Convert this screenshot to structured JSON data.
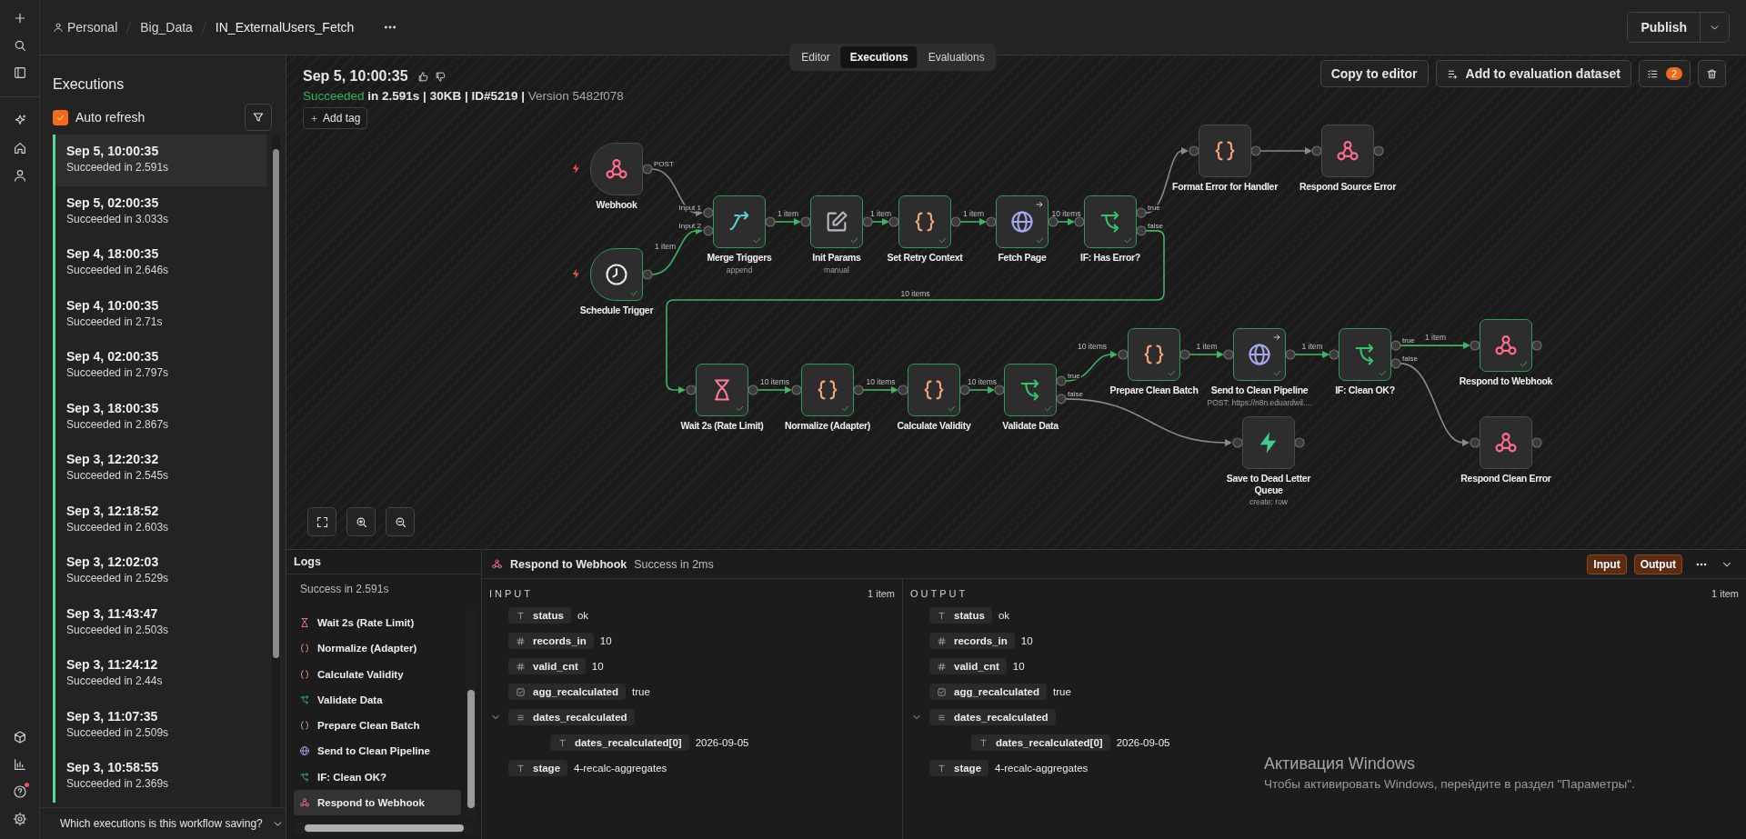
{
  "rail": {
    "top": [
      {
        "kind": "add",
        "alert": false
      },
      {
        "kind": "search",
        "alert": false
      },
      {
        "kind": "panel",
        "alert": false
      },
      {
        "kind": "sparkle",
        "alert": false
      },
      {
        "kind": "home",
        "alert": false
      },
      {
        "kind": "user",
        "alert": false
      }
    ],
    "bottom": [
      {
        "kind": "cube",
        "alert": false
      },
      {
        "kind": "chart",
        "alert": false
      },
      {
        "kind": "help",
        "alert": true
      },
      {
        "kind": "settings",
        "alert": false
      }
    ]
  },
  "breadcrumb": [
    "Personal",
    "Big_Data",
    "IN_ExternalUsers_Fetch"
  ],
  "view_tabs": [
    {
      "label": "Editor",
      "selected": false
    },
    {
      "label": "Executions",
      "selected": true
    },
    {
      "label": "Evaluations",
      "selected": false
    }
  ],
  "publish": {
    "label": "Publish"
  },
  "executions": {
    "title": "Executions",
    "auto_refresh": {
      "label": "Auto refresh",
      "checked": true
    },
    "items": [
      {
        "time": "Sep 5, 10:00:35",
        "status": "Succeeded in 2.591s",
        "selected": true
      },
      {
        "time": "Sep 5, 02:00:35",
        "status": "Succeeded in 3.033s",
        "selected": false
      },
      {
        "time": "Sep 4, 18:00:35",
        "status": "Succeeded in 2.646s",
        "selected": false
      },
      {
        "time": "Sep 4, 10:00:35",
        "status": "Succeeded in 2.71s",
        "selected": false
      },
      {
        "time": "Sep 4, 02:00:35",
        "status": "Succeeded in 2.797s",
        "selected": false
      },
      {
        "time": "Sep 3, 18:00:35",
        "status": "Succeeded in 2.867s",
        "selected": false
      },
      {
        "time": "Sep 3, 12:20:32",
        "status": "Succeeded in 2.545s",
        "selected": false
      },
      {
        "time": "Sep 3, 12:18:52",
        "status": "Succeeded in 2.603s",
        "selected": false
      },
      {
        "time": "Sep 3, 12:02:03",
        "status": "Succeeded in 2.529s",
        "selected": false
      },
      {
        "time": "Sep 3, 11:43:47",
        "status": "Succeeded in 2.503s",
        "selected": false
      },
      {
        "time": "Sep 3, 11:24:12",
        "status": "Succeeded in 2.44s",
        "selected": false
      },
      {
        "time": "Sep 3, 11:07:35",
        "status": "Succeeded in 2.509s",
        "selected": false
      },
      {
        "time": "Sep 3, 10:58:55",
        "status": "Succeeded in 2.369s",
        "selected": false
      }
    ],
    "footer": "Which executions is this workflow saving?"
  },
  "execution": {
    "title": "Sep 5, 10:00:35",
    "status": "Succeeded",
    "details": "in 2.591s | 30KB | ID#5219 |",
    "version": "Version 5482f078",
    "add_tag": "Add tag",
    "copy": "Copy to editor",
    "add_dataset": "Add to evaluation dataset",
    "badge": "2"
  },
  "nodes": [
    {
      "name": "Webhook",
      "kind": "trigger",
      "executed": false,
      "link_arrow": false,
      "outputs": [
        "POST"
      ]
    },
    {
      "name": "Schedule Trigger",
      "kind": "trigger",
      "executed": true,
      "link_arrow": false
    },
    {
      "name": "Merge Triggers",
      "subtitle": "append",
      "kind": "action",
      "executed": true,
      "link_arrow": false,
      "inputs": [
        "Input 1",
        "Input 2"
      ]
    },
    {
      "name": "Init Params",
      "subtitle": "manual",
      "kind": "action",
      "executed": true,
      "link_arrow": false
    },
    {
      "name": "Set Retry Context",
      "kind": "action",
      "executed": true,
      "link_arrow": false
    },
    {
      "name": "Fetch Page",
      "kind": "action",
      "executed": true,
      "link_arrow": true
    },
    {
      "name": "IF: Has Error?",
      "kind": "action",
      "executed": true,
      "link_arrow": false,
      "outputs": [
        "true",
        "false"
      ]
    },
    {
      "name": "Format Error for Handler",
      "kind": "action",
      "executed": false,
      "link_arrow": false
    },
    {
      "name": "Respond Source Error",
      "kind": "action",
      "executed": false,
      "link_arrow": false
    },
    {
      "name": "Wait 2s (Rate Limit)",
      "kind": "action",
      "executed": true,
      "link_arrow": false
    },
    {
      "name": "Normalize (Adapter)",
      "kind": "action",
      "executed": true,
      "link_arrow": false
    },
    {
      "name": "Calculate Validity",
      "kind": "action",
      "executed": true,
      "link_arrow": false
    },
    {
      "name": "Validate Data",
      "kind": "action",
      "executed": true,
      "link_arrow": false,
      "outputs": [
        "true",
        "false"
      ]
    },
    {
      "name": "Prepare Clean Batch",
      "kind": "action",
      "executed": true,
      "link_arrow": false
    },
    {
      "name": "Send to Clean Pipeline",
      "subtitle": "POST: https://n8n.eduardwil....",
      "kind": "action",
      "executed": true,
      "link_arrow": true
    },
    {
      "name": "IF: Clean OK?",
      "kind": "action",
      "executed": true,
      "link_arrow": false,
      "outputs": [
        "true",
        "false"
      ]
    },
    {
      "name": "Respond to Webhook",
      "kind": "action",
      "executed": true,
      "link_arrow": false
    },
    {
      "name": "Save to Dead Letter Queue",
      "subtitle": "create: row",
      "kind": "action",
      "executed": false,
      "link_arrow": false
    },
    {
      "name": "Respond Clean Error",
      "kind": "action",
      "executed": false,
      "link_arrow": false
    }
  ],
  "edges": [
    {
      "success": false
    },
    {
      "label": "1 item",
      "success": true
    },
    {
      "label": "1 item",
      "success": true
    },
    {
      "label": "1 item",
      "success": true
    },
    {
      "label": "1 item",
      "success": true
    },
    {
      "label": "10 items",
      "success": true
    },
    {
      "success": false
    },
    {
      "success": false
    },
    {
      "label": "10 items",
      "success": true
    },
    {
      "label": "10 items",
      "success": true
    },
    {
      "label": "10 items",
      "success": true
    },
    {
      "label": "10 items",
      "success": true
    },
    {
      "label": "10 items",
      "success": true
    },
    {
      "success": false
    },
    {
      "label": "1 item",
      "success": true
    },
    {
      "label": "1 item",
      "success": true
    },
    {
      "label": "1 item",
      "success": true
    },
    {
      "success": false
    }
  ],
  "logs": {
    "title": "Logs",
    "summary": "Success in 2.591s",
    "items": [
      {
        "name": "Wait 2s (Rate Limit)",
        "selected": false
      },
      {
        "name": "Normalize (Adapter)",
        "selected": false
      },
      {
        "name": "Calculate Validity",
        "selected": false
      },
      {
        "name": "Validate Data",
        "selected": false
      },
      {
        "name": "Prepare Clean Batch",
        "selected": false
      },
      {
        "name": "Send to Clean Pipeline",
        "selected": false
      },
      {
        "name": "IF: Clean OK?",
        "selected": false
      },
      {
        "name": "Respond to Webhook",
        "selected": true
      }
    ]
  },
  "node_panel": {
    "node": "Respond to Webhook",
    "status": "Success in 2ms",
    "buttons": [
      "Input",
      "Output"
    ],
    "panes": [
      {
        "title": "INPUT",
        "count": "1 item",
        "fields": [
          {
            "kind": "string",
            "key": "status",
            "value": "ok"
          },
          {
            "kind": "number",
            "key": "records_in",
            "value": "10"
          },
          {
            "kind": "number",
            "key": "valid_cnt",
            "value": "10"
          },
          {
            "kind": "boolean",
            "key": "agg_recalculated",
            "value": "true"
          },
          {
            "kind": "array",
            "key": "dates_recalculated",
            "expanded": true,
            "children": [
              {
                "kind": "string",
                "key": "dates_recalculated[0]",
                "value": "2026-09-05"
              }
            ]
          },
          {
            "kind": "string",
            "key": "stage",
            "value": "4-recalc-aggregates"
          }
        ]
      },
      {
        "title": "OUTPUT",
        "count": "1 item",
        "fields": [
          {
            "kind": "string",
            "key": "status",
            "value": "ok"
          },
          {
            "kind": "number",
            "key": "records_in",
            "value": "10"
          },
          {
            "kind": "number",
            "key": "valid_cnt",
            "value": "10"
          },
          {
            "kind": "boolean",
            "key": "agg_recalculated",
            "value": "true"
          },
          {
            "kind": "array",
            "key": "dates_recalculated",
            "expanded": true,
            "children": [
              {
                "kind": "string",
                "key": "dates_recalculated[0]",
                "value": "2026-09-05"
              }
            ]
          },
          {
            "kind": "string",
            "key": "stage",
            "value": "4-recalc-aggregates"
          }
        ]
      }
    ]
  },
  "windows_notice": {
    "title": "Активация Windows",
    "message": "Чтобы активировать Windows, перейдите в раздел \"Параметры\"."
  }
}
